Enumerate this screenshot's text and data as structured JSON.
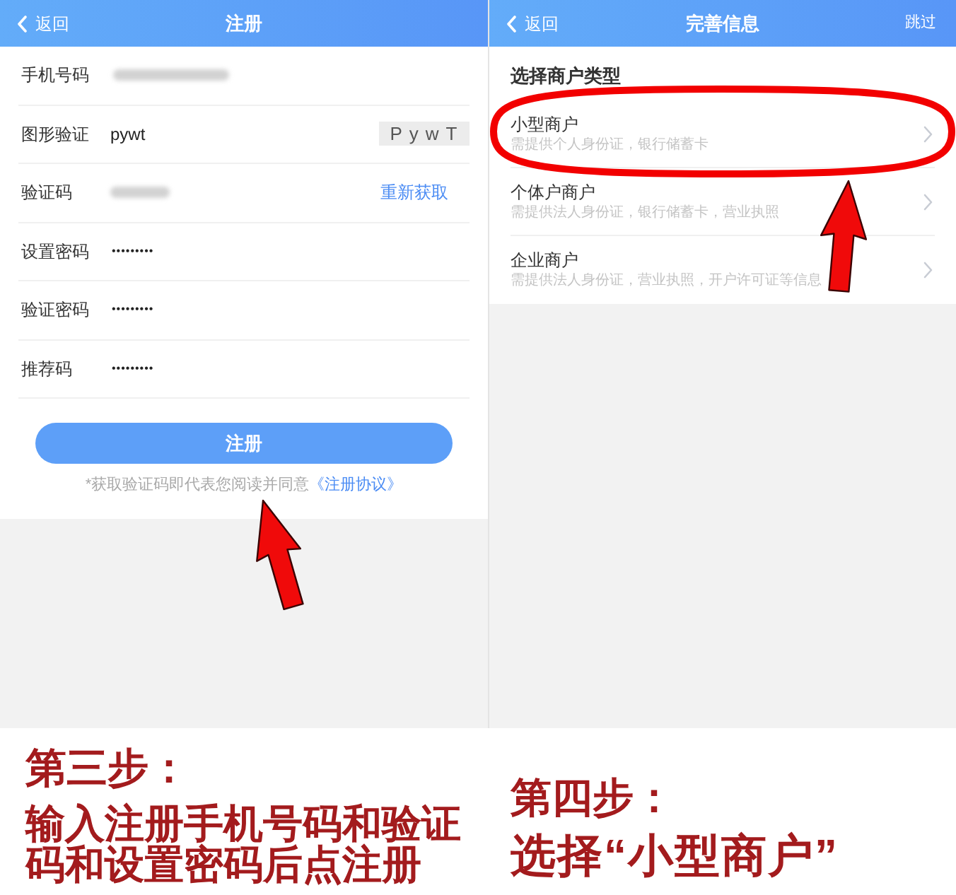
{
  "left_screen": {
    "header": {
      "back": "返回",
      "title": "注册"
    },
    "fields": [
      {
        "kind": "phone",
        "label": "手机号码"
      },
      {
        "kind": "captcha",
        "label": "图形验证",
        "value": "pywt",
        "captcha": "PywT"
      },
      {
        "kind": "sms_code",
        "label": "验证码",
        "action": "重新获取"
      },
      {
        "kind": "password",
        "label": "设置密码",
        "value": "•••••••••"
      },
      {
        "kind": "password",
        "label": "验证密码",
        "value": "•••••••••"
      },
      {
        "kind": "password",
        "label": "推荐码",
        "value": "•••••••••"
      }
    ],
    "submit_button": "注册",
    "agreement": {
      "text": "*获取验证码即代表您阅读并同意",
      "link": "《注册协议》"
    }
  },
  "right_screen": {
    "header": {
      "back": "返回",
      "title": "完善信息",
      "skip": "跳过"
    },
    "section_title": "选择商户类型",
    "options": [
      {
        "title": "小型商户",
        "description": "需提供个人身份证，银行储蓄卡",
        "circled": true
      },
      {
        "title": "个体户商户",
        "description": "需提供法人身份证，银行储蓄卡，营业执照",
        "circled": false
      },
      {
        "title": "企业商户",
        "description": "需提供法人身份证，营业执照，开户许可证等信息",
        "circled": false
      }
    ]
  },
  "captions": [
    {
      "heading": "第三步：",
      "body": "输入注册手机号码和验证码和设置密码后点注册"
    },
    {
      "heading": "第四步：",
      "body": "选择“小型商户”"
    }
  ]
}
